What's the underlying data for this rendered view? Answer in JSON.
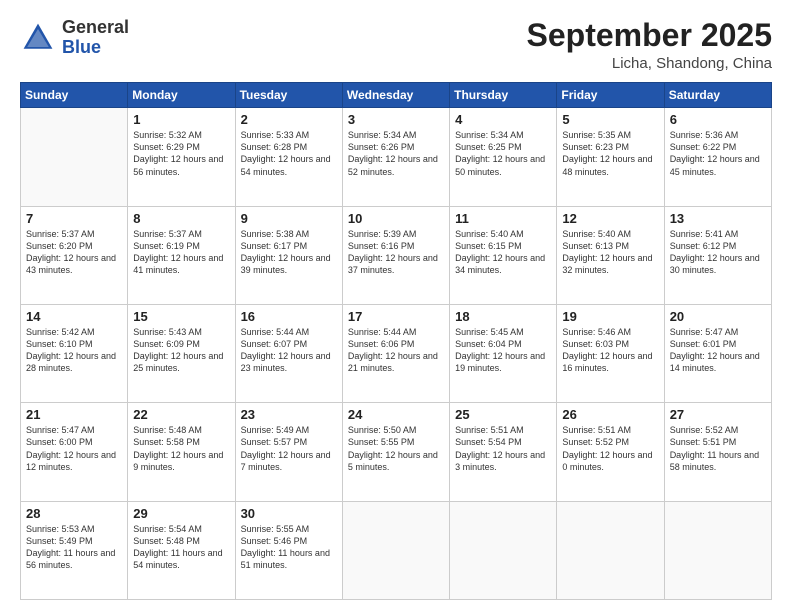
{
  "header": {
    "logo_general": "General",
    "logo_blue": "Blue",
    "month_title": "September 2025",
    "location": "Licha, Shandong, China"
  },
  "days_of_week": [
    "Sunday",
    "Monday",
    "Tuesday",
    "Wednesday",
    "Thursday",
    "Friday",
    "Saturday"
  ],
  "weeks": [
    [
      {
        "day": "",
        "info": ""
      },
      {
        "day": "1",
        "info": "Sunrise: 5:32 AM\nSunset: 6:29 PM\nDaylight: 12 hours\nand 56 minutes."
      },
      {
        "day": "2",
        "info": "Sunrise: 5:33 AM\nSunset: 6:28 PM\nDaylight: 12 hours\nand 54 minutes."
      },
      {
        "day": "3",
        "info": "Sunrise: 5:34 AM\nSunset: 6:26 PM\nDaylight: 12 hours\nand 52 minutes."
      },
      {
        "day": "4",
        "info": "Sunrise: 5:34 AM\nSunset: 6:25 PM\nDaylight: 12 hours\nand 50 minutes."
      },
      {
        "day": "5",
        "info": "Sunrise: 5:35 AM\nSunset: 6:23 PM\nDaylight: 12 hours\nand 48 minutes."
      },
      {
        "day": "6",
        "info": "Sunrise: 5:36 AM\nSunset: 6:22 PM\nDaylight: 12 hours\nand 45 minutes."
      }
    ],
    [
      {
        "day": "7",
        "info": "Sunrise: 5:37 AM\nSunset: 6:20 PM\nDaylight: 12 hours\nand 43 minutes."
      },
      {
        "day": "8",
        "info": "Sunrise: 5:37 AM\nSunset: 6:19 PM\nDaylight: 12 hours\nand 41 minutes."
      },
      {
        "day": "9",
        "info": "Sunrise: 5:38 AM\nSunset: 6:17 PM\nDaylight: 12 hours\nand 39 minutes."
      },
      {
        "day": "10",
        "info": "Sunrise: 5:39 AM\nSunset: 6:16 PM\nDaylight: 12 hours\nand 37 minutes."
      },
      {
        "day": "11",
        "info": "Sunrise: 5:40 AM\nSunset: 6:15 PM\nDaylight: 12 hours\nand 34 minutes."
      },
      {
        "day": "12",
        "info": "Sunrise: 5:40 AM\nSunset: 6:13 PM\nDaylight: 12 hours\nand 32 minutes."
      },
      {
        "day": "13",
        "info": "Sunrise: 5:41 AM\nSunset: 6:12 PM\nDaylight: 12 hours\nand 30 minutes."
      }
    ],
    [
      {
        "day": "14",
        "info": "Sunrise: 5:42 AM\nSunset: 6:10 PM\nDaylight: 12 hours\nand 28 minutes."
      },
      {
        "day": "15",
        "info": "Sunrise: 5:43 AM\nSunset: 6:09 PM\nDaylight: 12 hours\nand 25 minutes."
      },
      {
        "day": "16",
        "info": "Sunrise: 5:44 AM\nSunset: 6:07 PM\nDaylight: 12 hours\nand 23 minutes."
      },
      {
        "day": "17",
        "info": "Sunrise: 5:44 AM\nSunset: 6:06 PM\nDaylight: 12 hours\nand 21 minutes."
      },
      {
        "day": "18",
        "info": "Sunrise: 5:45 AM\nSunset: 6:04 PM\nDaylight: 12 hours\nand 19 minutes."
      },
      {
        "day": "19",
        "info": "Sunrise: 5:46 AM\nSunset: 6:03 PM\nDaylight: 12 hours\nand 16 minutes."
      },
      {
        "day": "20",
        "info": "Sunrise: 5:47 AM\nSunset: 6:01 PM\nDaylight: 12 hours\nand 14 minutes."
      }
    ],
    [
      {
        "day": "21",
        "info": "Sunrise: 5:47 AM\nSunset: 6:00 PM\nDaylight: 12 hours\nand 12 minutes."
      },
      {
        "day": "22",
        "info": "Sunrise: 5:48 AM\nSunset: 5:58 PM\nDaylight: 12 hours\nand 9 minutes."
      },
      {
        "day": "23",
        "info": "Sunrise: 5:49 AM\nSunset: 5:57 PM\nDaylight: 12 hours\nand 7 minutes."
      },
      {
        "day": "24",
        "info": "Sunrise: 5:50 AM\nSunset: 5:55 PM\nDaylight: 12 hours\nand 5 minutes."
      },
      {
        "day": "25",
        "info": "Sunrise: 5:51 AM\nSunset: 5:54 PM\nDaylight: 12 hours\nand 3 minutes."
      },
      {
        "day": "26",
        "info": "Sunrise: 5:51 AM\nSunset: 5:52 PM\nDaylight: 12 hours\nand 0 minutes."
      },
      {
        "day": "27",
        "info": "Sunrise: 5:52 AM\nSunset: 5:51 PM\nDaylight: 11 hours\nand 58 minutes."
      }
    ],
    [
      {
        "day": "28",
        "info": "Sunrise: 5:53 AM\nSunset: 5:49 PM\nDaylight: 11 hours\nand 56 minutes."
      },
      {
        "day": "29",
        "info": "Sunrise: 5:54 AM\nSunset: 5:48 PM\nDaylight: 11 hours\nand 54 minutes."
      },
      {
        "day": "30",
        "info": "Sunrise: 5:55 AM\nSunset: 5:46 PM\nDaylight: 11 hours\nand 51 minutes."
      },
      {
        "day": "",
        "info": ""
      },
      {
        "day": "",
        "info": ""
      },
      {
        "day": "",
        "info": ""
      },
      {
        "day": "",
        "info": ""
      }
    ]
  ]
}
